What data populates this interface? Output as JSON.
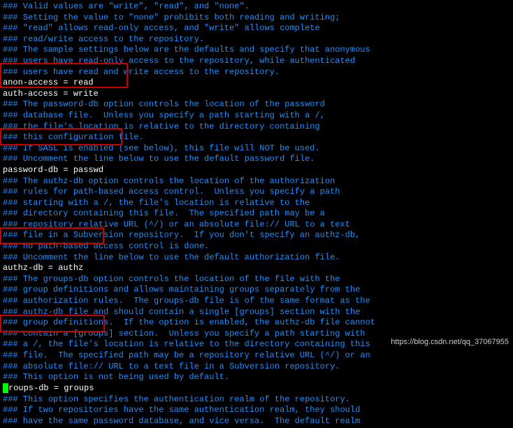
{
  "lines": [
    {
      "cls": "comment",
      "text": "### Valid values are \"write\", \"read\", and \"none\"."
    },
    {
      "cls": "comment",
      "text": "### Setting the value to \"none\" prohibits both reading and writing;"
    },
    {
      "cls": "comment",
      "text": "### \"read\" allows read-only access, and \"write\" allows complete"
    },
    {
      "cls": "comment",
      "text": "### read/write access to the repository."
    },
    {
      "cls": "comment",
      "text": "### The sample settings below are the defaults and specify that anonymous"
    },
    {
      "cls": "comment",
      "text": "### users have read-only access to the repository, while authenticated"
    },
    {
      "cls": "comment",
      "text": "### users have read and write access to the repository."
    },
    {
      "cls": "active",
      "text": "anon-access = read"
    },
    {
      "cls": "active",
      "text": "auth-access = write"
    },
    {
      "cls": "comment",
      "text": "### The password-db option controls the location of the password"
    },
    {
      "cls": "comment",
      "text": "### database file.  Unless you specify a path starting with a /,"
    },
    {
      "cls": "comment",
      "text": "### the file's location is relative to the directory containing"
    },
    {
      "cls": "comment",
      "text": "### this configuration file."
    },
    {
      "cls": "comment",
      "text": "### If SASL is enabled (see below), this file will NOT be used."
    },
    {
      "cls": "comment",
      "text": "### Uncomment the line below to use the default password file."
    },
    {
      "cls": "active",
      "text": "password-db = passwd"
    },
    {
      "cls": "comment",
      "text": "### The authz-db option controls the location of the authorization"
    },
    {
      "cls": "comment",
      "text": "### rules for path-based access control.  Unless you specify a path"
    },
    {
      "cls": "comment",
      "text": "### starting with a /, the file's location is relative to the"
    },
    {
      "cls": "comment",
      "text": "### directory containing this file.  The specified path may be a"
    },
    {
      "cls": "comment",
      "text": "### repository relative URL (^/) or an absolute file:// URL to a text"
    },
    {
      "cls": "comment",
      "text": "### file in a Subversion repository.  If you don't specify an authz-db,"
    },
    {
      "cls": "comment",
      "text": "### no path-based access control is done."
    },
    {
      "cls": "comment",
      "text": "### Uncomment the line below to use the default authorization file."
    },
    {
      "cls": "active",
      "text": "authz-db = authz"
    },
    {
      "cls": "comment",
      "text": "### The groups-db option controls the location of the file with the"
    },
    {
      "cls": "comment",
      "text": "### group definitions and allows maintaining groups separately from the"
    },
    {
      "cls": "comment",
      "text": "### authorization rules.  The groups-db file is of the same format as the"
    },
    {
      "cls": "comment",
      "text": "### authz-db file and should contain a single [groups] section with the"
    },
    {
      "cls": "comment",
      "text": "### group definitions.  If the option is enabled, the authz-db file cannot"
    },
    {
      "cls": "comment",
      "text": "### contain a [groups] section.  Unless you specify a path starting with"
    },
    {
      "cls": "comment",
      "text": "### a /, the file's location is relative to the directory containing this"
    },
    {
      "cls": "comment",
      "text": "### file.  The specified path may be a repository relative URL (^/) or an"
    },
    {
      "cls": "comment",
      "text": "### absolute file:// URL to a text file in a Subversion repository."
    },
    {
      "cls": "comment",
      "text": "### This option is not being used by default."
    },
    {
      "cls": "active",
      "text": "groups-db = groups",
      "cursor": true
    },
    {
      "cls": "comment",
      "text": "### This option specifies the authentication realm of the repository."
    },
    {
      "cls": "comment",
      "text": "### If two repositories have the same authentication realm, they should"
    },
    {
      "cls": "comment",
      "text": "### have the same password database, and vice versa.  The default realm"
    }
  ],
  "watermark": "https://blog.csdn.net/qq_37067955"
}
